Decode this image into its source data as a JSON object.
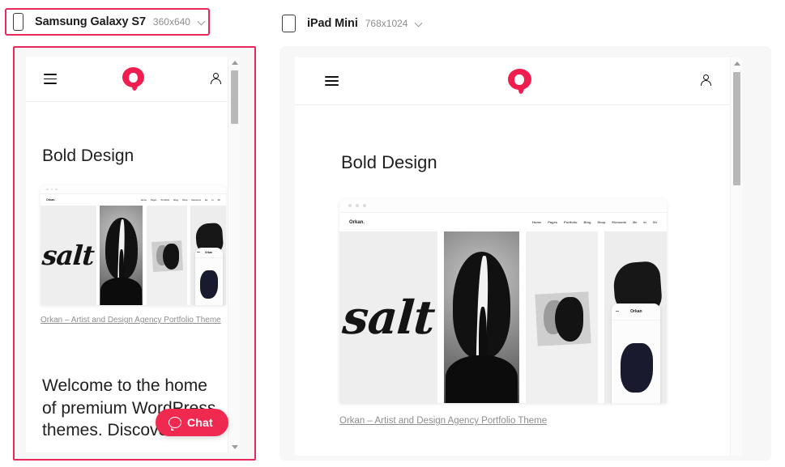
{
  "devices": [
    {
      "key": "mobile",
      "name": "Samsung Galaxy S7",
      "resolution": "360x640",
      "selected": true,
      "glyph": "phone-icon",
      "chevron": "chevron-down-icon"
    },
    {
      "key": "tablet",
      "name": "iPad Mini",
      "resolution": "768x1024",
      "selected": false,
      "glyph": "tablet-icon",
      "chevron": "chevron-down-icon"
    }
  ],
  "site": {
    "topbar": {
      "menu_icon": "hamburger-icon",
      "logo_icon": "brand-logo-icon",
      "account_icon": "user-account-icon"
    },
    "heading": "Bold Design",
    "caption_link": "Orkan – Artist and Design Agency Portfolio Theme",
    "welcome_text": "Welcome to the home of premium WordPress themes. Discover the",
    "showcase": {
      "brand": "Orkan.",
      "nav_items": [
        "Home",
        "Pages",
        "Portfolio",
        "Blog",
        "Shop",
        "Elements"
      ],
      "nav_extra": [
        "Be",
        "In",
        "Sh"
      ],
      "hero_word": "salt",
      "phone_mock_brand": "Orkan"
    }
  },
  "chat": {
    "label": "Chat",
    "icon": "chat-bubble-icon"
  },
  "scrollbars": {
    "up_icon": "scroll-up-arrow-icon",
    "down_icon": "scroll-down-arrow-icon"
  },
  "colors": {
    "accent": "#ef1e4e",
    "selection_border": "#e8275a",
    "chat_bg": "#ef2950",
    "text": "#1f1f1f",
    "muted": "#8e8e8e"
  }
}
